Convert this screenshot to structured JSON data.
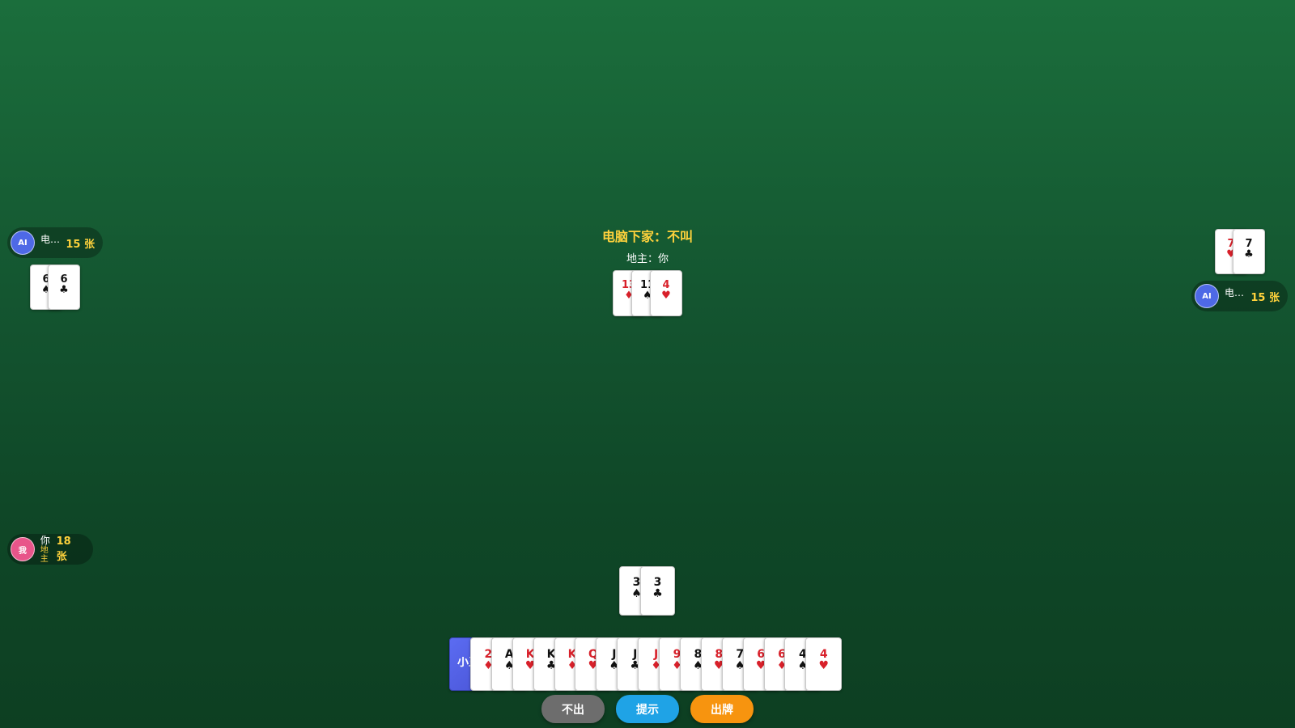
{
  "status": {
    "last_action": "电脑下家：不叫",
    "landlord_label": "地主：你"
  },
  "players": {
    "left": {
      "avatar": "AI",
      "name": "电…",
      "count": "15 张"
    },
    "right": {
      "avatar": "AI",
      "name": "电…",
      "count": "15 张"
    },
    "me": {
      "avatar": "我",
      "name": "你",
      "role": "地主",
      "count": "18 张"
    }
  },
  "left_played": [
    {
      "rank": "6",
      "suit": "♠",
      "color": "black"
    },
    {
      "rank": "6",
      "suit": "♣",
      "color": "black"
    }
  ],
  "right_played": [
    {
      "rank": "7",
      "suit": "♥",
      "color": "red"
    },
    {
      "rank": "7",
      "suit": "♣",
      "color": "black"
    }
  ],
  "bottom_cards": [
    {
      "rank": "13",
      "suit": "♦",
      "color": "red"
    },
    {
      "rank": "11",
      "suit": "♠",
      "color": "black"
    },
    {
      "rank": "4",
      "suit": "♥",
      "color": "red"
    }
  ],
  "my_played": [
    {
      "rank": "3",
      "suit": "♠",
      "color": "black"
    },
    {
      "rank": "3",
      "suit": "♣",
      "color": "black"
    }
  ],
  "hand": [
    {
      "rank": "小王",
      "suit": "",
      "color": "joker"
    },
    {
      "rank": "2",
      "suit": "♦",
      "color": "red"
    },
    {
      "rank": "A",
      "suit": "♠",
      "color": "black"
    },
    {
      "rank": "K",
      "suit": "♥",
      "color": "red"
    },
    {
      "rank": "K",
      "suit": "♣",
      "color": "black"
    },
    {
      "rank": "K",
      "suit": "♦",
      "color": "red"
    },
    {
      "rank": "Q",
      "suit": "♥",
      "color": "red"
    },
    {
      "rank": "J",
      "suit": "♠",
      "color": "black"
    },
    {
      "rank": "J",
      "suit": "♣",
      "color": "black"
    },
    {
      "rank": "J",
      "suit": "♦",
      "color": "red"
    },
    {
      "rank": "9",
      "suit": "♦",
      "color": "red"
    },
    {
      "rank": "8",
      "suit": "♠",
      "color": "black"
    },
    {
      "rank": "8",
      "suit": "♥",
      "color": "red"
    },
    {
      "rank": "7",
      "suit": "♠",
      "color": "black"
    },
    {
      "rank": "6",
      "suit": "♥",
      "color": "red"
    },
    {
      "rank": "6",
      "suit": "♦",
      "color": "red"
    },
    {
      "rank": "4",
      "suit": "♠",
      "color": "black"
    },
    {
      "rank": "4",
      "suit": "♥",
      "color": "red"
    }
  ],
  "buttons": {
    "pass": {
      "label": "不出",
      "color": "#6d6d6d"
    },
    "hint": {
      "label": "提示",
      "color": "#1fa3e6"
    },
    "play": {
      "label": "出牌",
      "color": "#f7940f"
    }
  }
}
